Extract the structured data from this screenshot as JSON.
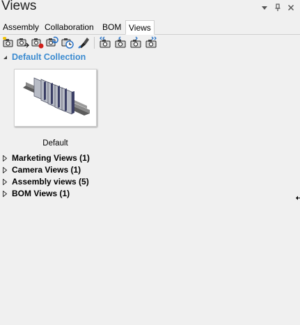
{
  "panel": {
    "title": "Views"
  },
  "tabs": [
    {
      "label": "Assembly"
    },
    {
      "label": "Collaboration"
    },
    {
      "label": "BOM"
    },
    {
      "label": "Views",
      "active": true
    }
  ],
  "toolbar": {
    "left_icons": [
      "new-view-icon",
      "update-view-icon",
      "record-view-icon",
      "save-view-icon",
      "schedule-view-icon",
      "style-brush-icon"
    ],
    "right_icons": [
      "camera-first-icon",
      "camera-prev-icon",
      "camera-next-icon",
      "camera-last-icon"
    ]
  },
  "collection": {
    "title": "Default Collection",
    "thumbnail_label": "Default"
  },
  "groups": [
    {
      "label": "Marketing Views (1)"
    },
    {
      "label": "Camera Views (1)"
    },
    {
      "label": "Assembly views (5)"
    },
    {
      "label": "BOM Views (1)"
    }
  ],
  "colors": {
    "accent": "#3b8bd0",
    "background": "#f0f0f0"
  }
}
